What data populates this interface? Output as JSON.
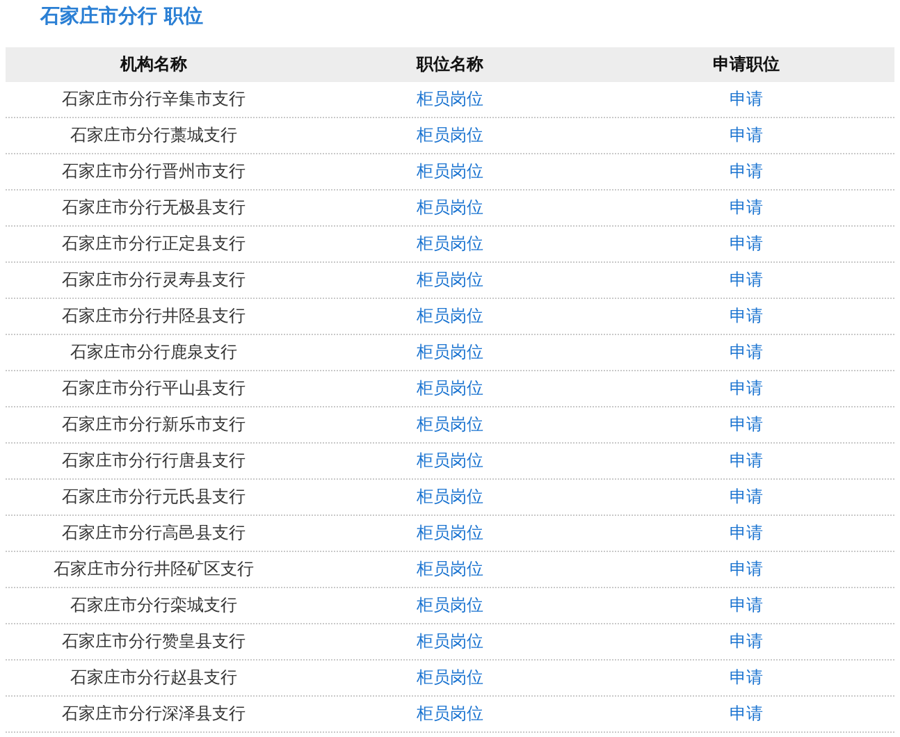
{
  "title": "石家庄市分行 职位",
  "table": {
    "columns": [
      "机构名称",
      "职位名称",
      "申请职位"
    ],
    "rows": [
      {
        "branch": "石家庄市分行辛集市支行",
        "position": "柜员岗位",
        "action": "申请"
      },
      {
        "branch": "石家庄市分行藁城支行",
        "position": "柜员岗位",
        "action": "申请"
      },
      {
        "branch": "石家庄市分行晋州市支行",
        "position": "柜员岗位",
        "action": "申请"
      },
      {
        "branch": "石家庄市分行无极县支行",
        "position": "柜员岗位",
        "action": "申请"
      },
      {
        "branch": "石家庄市分行正定县支行",
        "position": "柜员岗位",
        "action": "申请"
      },
      {
        "branch": "石家庄市分行灵寿县支行",
        "position": "柜员岗位",
        "action": "申请"
      },
      {
        "branch": "石家庄市分行井陉县支行",
        "position": "柜员岗位",
        "action": "申请"
      },
      {
        "branch": "石家庄市分行鹿泉支行",
        "position": "柜员岗位",
        "action": "申请"
      },
      {
        "branch": "石家庄市分行平山县支行",
        "position": "柜员岗位",
        "action": "申请"
      },
      {
        "branch": "石家庄市分行新乐市支行",
        "position": "柜员岗位",
        "action": "申请"
      },
      {
        "branch": "石家庄市分行行唐县支行",
        "position": "柜员岗位",
        "action": "申请"
      },
      {
        "branch": "石家庄市分行元氏县支行",
        "position": "柜员岗位",
        "action": "申请"
      },
      {
        "branch": "石家庄市分行高邑县支行",
        "position": "柜员岗位",
        "action": "申请"
      },
      {
        "branch": "石家庄市分行井陉矿区支行",
        "position": "柜员岗位",
        "action": "申请"
      },
      {
        "branch": "石家庄市分行栾城支行",
        "position": "柜员岗位",
        "action": "申请"
      },
      {
        "branch": "石家庄市分行赞皇县支行",
        "position": "柜员岗位",
        "action": "申请"
      },
      {
        "branch": "石家庄市分行赵县支行",
        "position": "柜员岗位",
        "action": "申请"
      },
      {
        "branch": "石家庄市分行深泽县支行",
        "position": "柜员岗位",
        "action": "申请"
      }
    ]
  }
}
